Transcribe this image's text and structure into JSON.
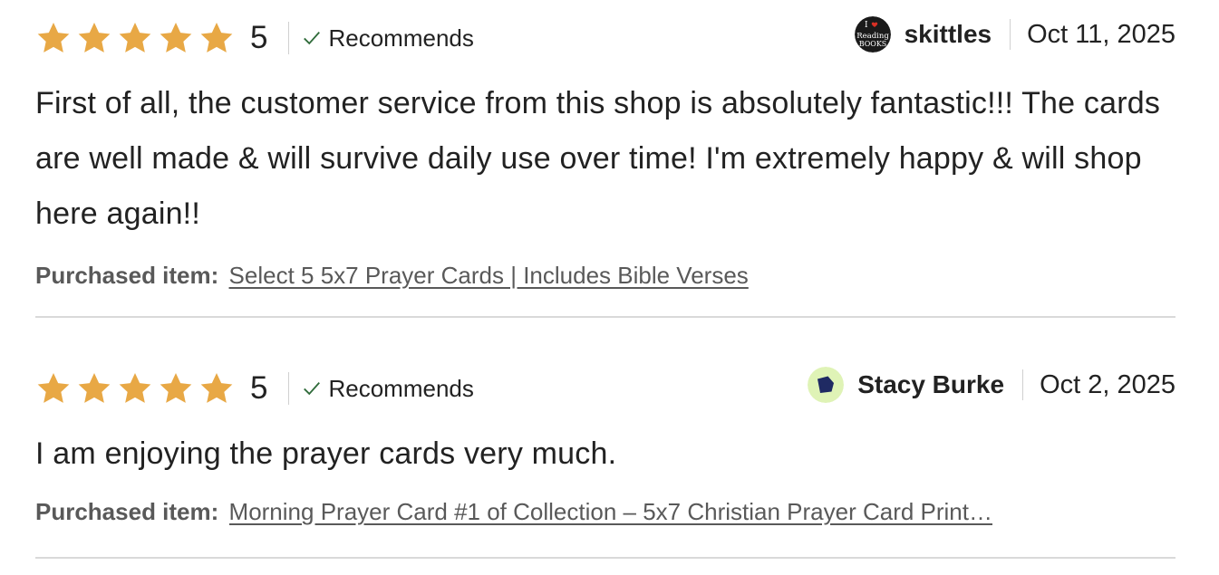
{
  "colors": {
    "star": "#E8A845",
    "text": "#222222",
    "muted": "#595959",
    "check": "#2F6B3A",
    "divider": "#D9D9D9"
  },
  "reviews": [
    {
      "rating": 5,
      "score_label": "5",
      "recommends_label": "Recommends",
      "author_name": "skittles",
      "avatar_text": [
        "I",
        "Reading",
        "BOOKS"
      ],
      "date": "Oct 11, 2025",
      "text": "First of all, the customer service from this shop is absolutely fantastic!!! The cards are well made & will survive daily use over time! I'm extremely happy & will shop here again!!",
      "purchased_label": "Purchased item:",
      "purchased_item": "Select 5 5x7 Prayer Cards | Includes Bible Verses"
    },
    {
      "rating": 5,
      "score_label": "5",
      "recommends_label": "Recommends",
      "author_name": "Stacy Burke",
      "date": "Oct 2, 2025",
      "text": "I am enjoying the prayer cards very much.",
      "purchased_label": "Purchased item:",
      "purchased_item": "Morning Prayer Card #1 of Collection – 5x7 Christian Prayer Card Print…"
    }
  ]
}
